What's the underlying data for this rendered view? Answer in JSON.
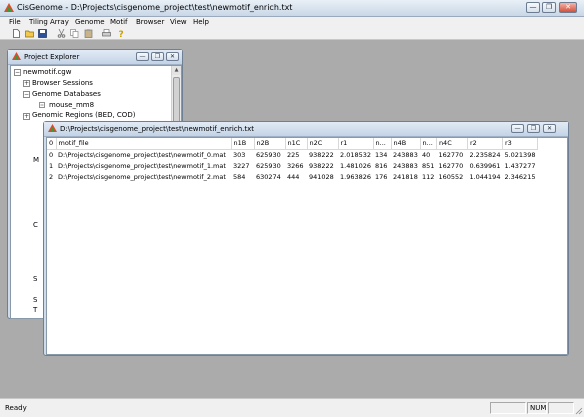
{
  "app": {
    "title": "CisGenome - D:\\Projects\\cisgenome_project\\test\\newmotif_enrich.txt"
  },
  "window_controls": {
    "minimize": "—",
    "maximize": "❐",
    "close": "✕"
  },
  "menu": [
    "File",
    "Tiling Array",
    "Genome",
    "Motif",
    "Browser",
    "View",
    "Help"
  ],
  "toolbar": [
    "new-file-icon",
    "open-folder-icon",
    "save-icon",
    "cut-icon",
    "copy-icon",
    "paste-icon",
    "print-icon",
    "help-icon"
  ],
  "project_explorer": {
    "title": "Project Explorer",
    "tree": {
      "root": "newmotif.cgw",
      "browser_sessions": "Browser Sessions",
      "genome_databases": "Genome Databases",
      "genome_db_item": "mouse_mm8",
      "genomic_regions": "Genomic Regions (BED, COD)"
    },
    "partial_labels": [
      "M",
      "C",
      "S",
      "S",
      "T"
    ]
  },
  "doc_window": {
    "title": "D:\\Projects\\cisgenome_project\\test\\newmotif_enrich.txt",
    "columns": [
      "0",
      "motif_file",
      "n1B",
      "n2B",
      "n1C",
      "n2C",
      "r1",
      "n...",
      "n4B",
      "n...",
      "n4C",
      "r2",
      "r3"
    ],
    "rows": [
      [
        "0",
        "D:\\Projects\\cisgenome_project\\test\\newmotif_0.mat",
        "303",
        "625930",
        "225",
        "938222",
        "2.018532",
        "134",
        "243883",
        "40",
        "162770",
        "2.235824",
        "5.021398"
      ],
      [
        "1",
        "D:\\Projects\\cisgenome_project\\test\\newmotif_1.mat",
        "3227",
        "625930",
        "3266",
        "938222",
        "1.481026",
        "816",
        "243883",
        "851",
        "162770",
        "0.639961",
        "1.437277"
      ],
      [
        "2",
        "D:\\Projects\\cisgenome_project\\test\\newmotif_2.mat",
        "584",
        "630274",
        "444",
        "941028",
        "1.963826",
        "176",
        "241818",
        "112",
        "160552",
        "1.044194",
        "2.346215"
      ]
    ]
  },
  "status": {
    "ready": "Ready",
    "num": "NUM"
  }
}
